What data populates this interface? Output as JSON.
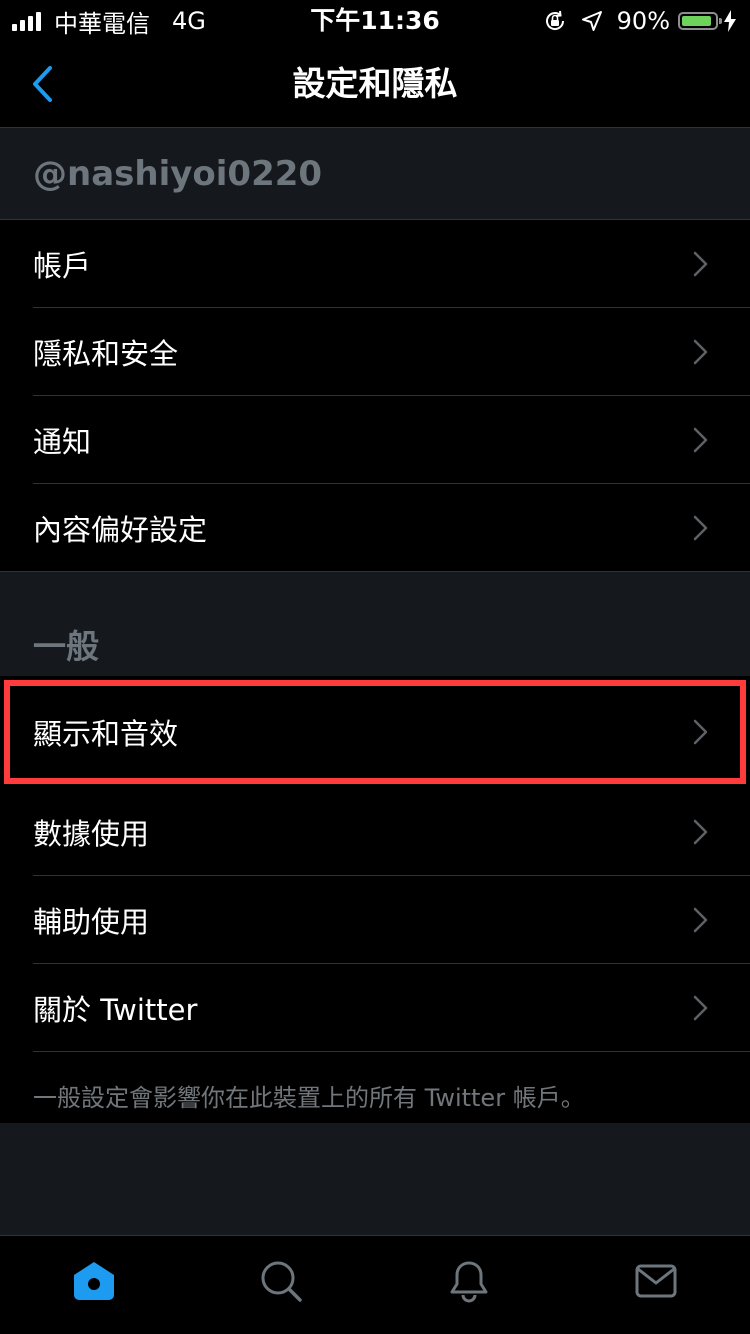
{
  "status_bar": {
    "carrier": "中華電信",
    "network": "4G",
    "time": "下午11:36",
    "battery_percent": "90%",
    "battery_level": 0.9,
    "icons": [
      "signal-icon",
      "orientation-lock-icon",
      "location-arrow-icon",
      "battery-icon",
      "charging-bolt-icon"
    ]
  },
  "nav": {
    "title": "設定和隱私",
    "back_icon": "chevron-left-icon"
  },
  "account_section": {
    "handle": "@nashiyoi0220",
    "items": [
      {
        "label": "帳戶"
      },
      {
        "label": "隱私和安全"
      },
      {
        "label": "通知"
      },
      {
        "label": "內容偏好設定"
      }
    ]
  },
  "general_section": {
    "header": "一般",
    "items": [
      {
        "label": "顯示和音效"
      },
      {
        "label": "數據使用"
      },
      {
        "label": "輔助使用"
      },
      {
        "label": "關於 Twitter"
      }
    ],
    "footnote": "一般設定會影響你在此裝置上的所有 Twitter 帳戶。"
  },
  "tab_bar": {
    "tabs": [
      {
        "icon": "home-icon",
        "active": true
      },
      {
        "icon": "search-icon",
        "active": false
      },
      {
        "icon": "bell-icon",
        "active": false
      },
      {
        "icon": "mail-icon",
        "active": false
      }
    ]
  },
  "colors": {
    "accent": "#1d9bf0",
    "highlight_border": "#ff3b3b",
    "section_background": "#15181c",
    "secondary_text": "#6e767d",
    "battery_green": "#6ed35b"
  }
}
